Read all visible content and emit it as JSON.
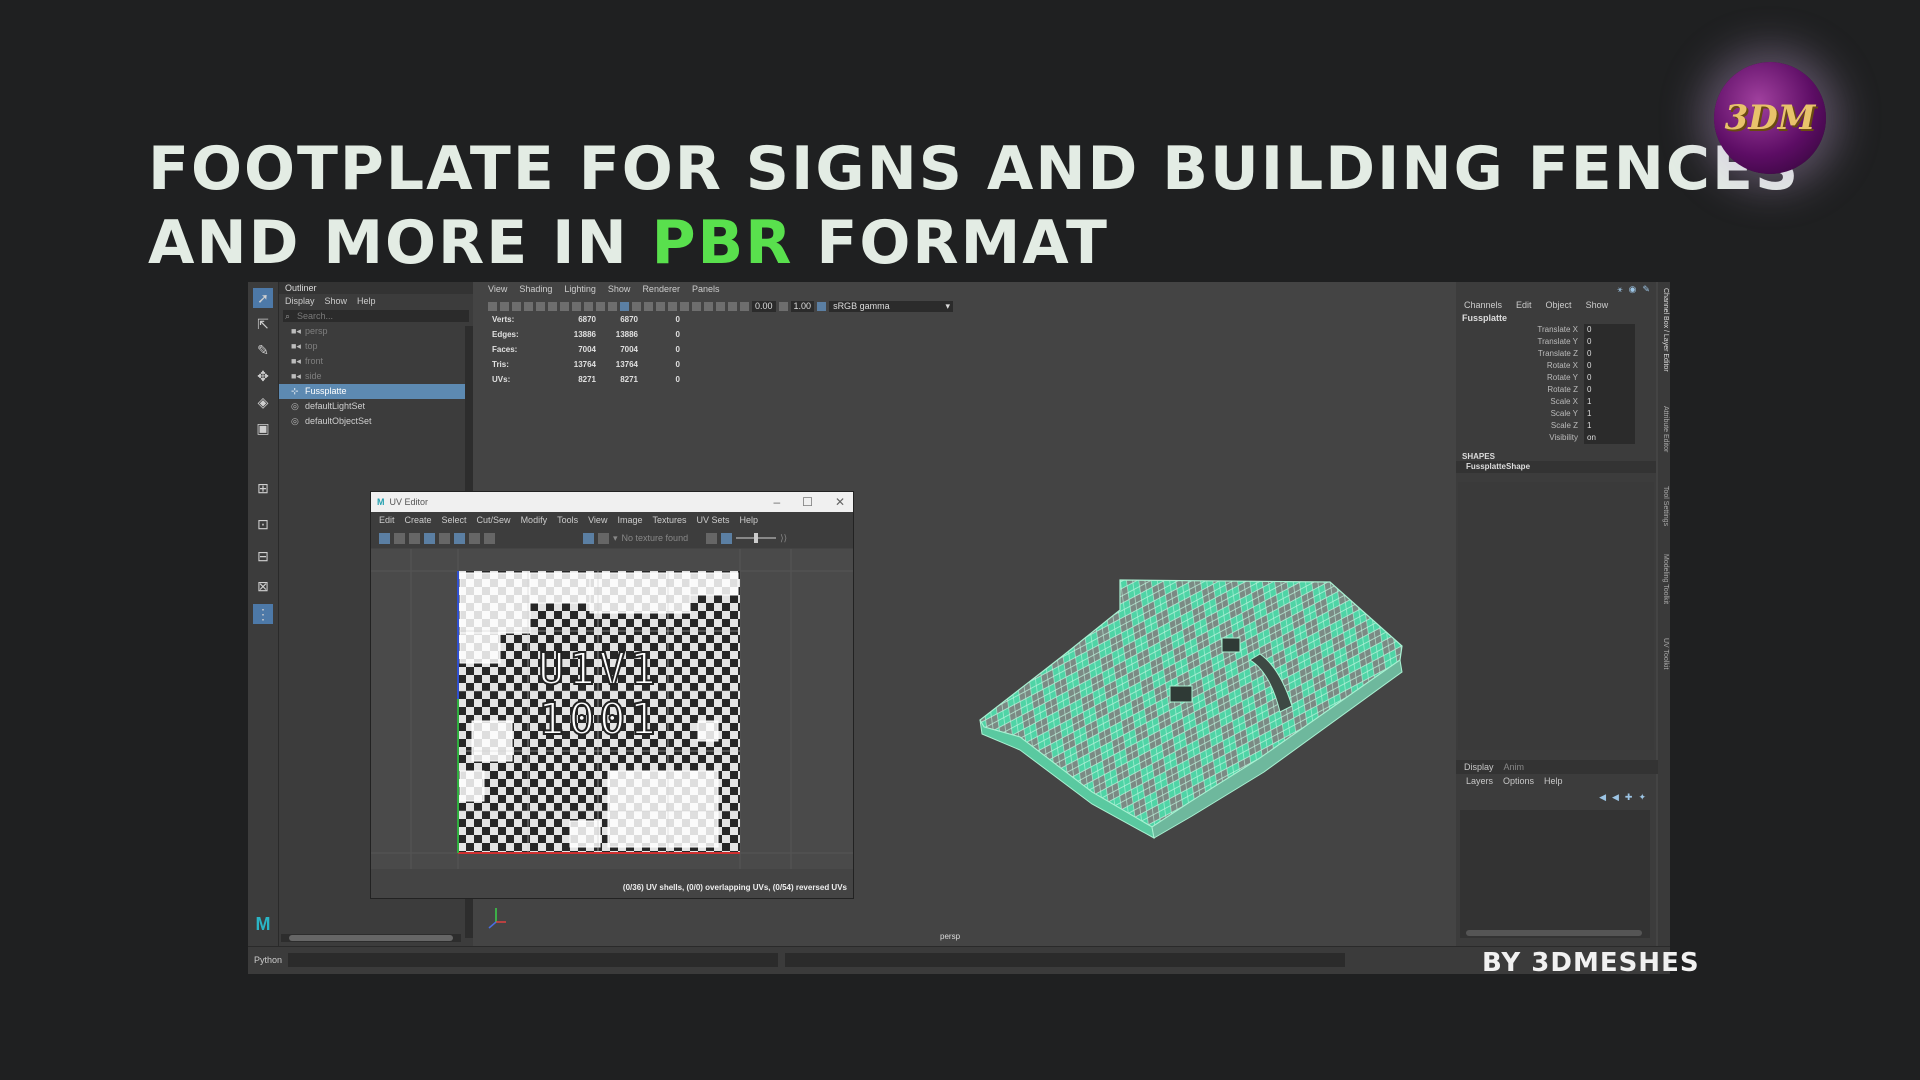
{
  "headline": {
    "line1": "FOOTPLATE FOR SIGNS AND BUILDING FENCES",
    "line2_pre": "AND MORE IN ",
    "line2_accent": "PBR",
    "line2_post": " FORMAT"
  },
  "logo_text": "3DM",
  "byline": "BY 3DMESHES",
  "outliner": {
    "title": "Outliner",
    "menu": [
      "Display",
      "Show",
      "Help"
    ],
    "search_placeholder": "Search...",
    "items": [
      {
        "label": "persp",
        "state": "dim"
      },
      {
        "label": "top",
        "state": "dim"
      },
      {
        "label": "front",
        "state": "dim"
      },
      {
        "label": "side",
        "state": "dim"
      },
      {
        "label": "Fussplatte",
        "state": "selected"
      },
      {
        "label": "defaultLightSet",
        "state": "normal"
      },
      {
        "label": "defaultObjectSet",
        "state": "normal"
      }
    ]
  },
  "viewport": {
    "menu": [
      "View",
      "Shading",
      "Lighting",
      "Show",
      "Renderer",
      "Panels"
    ],
    "exposure": "0.00",
    "gamma_value": "1.00",
    "color_space": "sRGB gamma",
    "hud": [
      {
        "label": "Verts:",
        "a": "6870",
        "b": "6870",
        "c": "0"
      },
      {
        "label": "Edges:",
        "a": "13886",
        "b": "13886",
        "c": "0"
      },
      {
        "label": "Faces:",
        "a": "7004",
        "b": "7004",
        "c": "0"
      },
      {
        "label": "Tris:",
        "a": "13764",
        "b": "13764",
        "c": "0"
      },
      {
        "label": "UVs:",
        "a": "8271",
        "b": "8271",
        "c": "0"
      }
    ],
    "camera_label": "persp"
  },
  "channel_box": {
    "menu": [
      "Channels",
      "Edit",
      "Object",
      "Show"
    ],
    "object_name": "Fussplatte",
    "attributes": [
      {
        "label": "Translate X",
        "value": "0"
      },
      {
        "label": "Translate Y",
        "value": "0"
      },
      {
        "label": "Translate Z",
        "value": "0"
      },
      {
        "label": "Rotate X",
        "value": "0"
      },
      {
        "label": "Rotate Y",
        "value": "0"
      },
      {
        "label": "Rotate Z",
        "value": "0"
      },
      {
        "label": "Scale X",
        "value": "1"
      },
      {
        "label": "Scale Y",
        "value": "1"
      },
      {
        "label": "Scale Z",
        "value": "1"
      },
      {
        "label": "Visibility",
        "value": "on"
      }
    ],
    "shapes_header": "SHAPES",
    "shape_name": "FussplatteShape",
    "layer_tabs": [
      "Display",
      "Anim"
    ],
    "layer_menu": [
      "Layers",
      "Options",
      "Help"
    ],
    "side_tabs": [
      "Channel Box / Layer Editor",
      "Attribute Editor",
      "Tool Settings",
      "Modeling Toolkit",
      "UV Toolkit"
    ]
  },
  "command_line": {
    "language": "Python"
  },
  "uv_editor": {
    "title": "UV Editor",
    "menu": [
      "Edit",
      "Create",
      "Select",
      "Cut/Sew",
      "Modify",
      "Tools",
      "View",
      "Image",
      "Textures",
      "UV Sets",
      "Help"
    ],
    "texture_status": "No texture found",
    "udim_label": "U1V1",
    "udim_number": "1001",
    "status": "(0/36) UV shells, (0/0) overlapping UVs, (0/54) reversed UVs"
  },
  "colors": {
    "accent_green": "#59e04d",
    "mesh_wire": "#5fe8b8",
    "selection_blue": "#5d8ab2",
    "logo_purple": "#5d0d65"
  }
}
